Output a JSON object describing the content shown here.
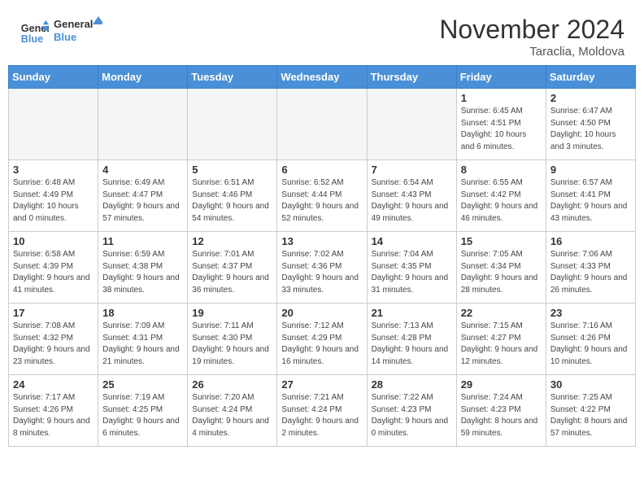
{
  "header": {
    "logo_line1": "General",
    "logo_line2": "Blue",
    "month": "November 2024",
    "location": "Taraclia, Moldova"
  },
  "days_of_week": [
    "Sunday",
    "Monday",
    "Tuesday",
    "Wednesday",
    "Thursday",
    "Friday",
    "Saturday"
  ],
  "weeks": [
    [
      {
        "day": "",
        "info": ""
      },
      {
        "day": "",
        "info": ""
      },
      {
        "day": "",
        "info": ""
      },
      {
        "day": "",
        "info": ""
      },
      {
        "day": "",
        "info": ""
      },
      {
        "day": "1",
        "info": "Sunrise: 6:45 AM\nSunset: 4:51 PM\nDaylight: 10 hours and 6 minutes."
      },
      {
        "day": "2",
        "info": "Sunrise: 6:47 AM\nSunset: 4:50 PM\nDaylight: 10 hours and 3 minutes."
      }
    ],
    [
      {
        "day": "3",
        "info": "Sunrise: 6:48 AM\nSunset: 4:49 PM\nDaylight: 10 hours and 0 minutes."
      },
      {
        "day": "4",
        "info": "Sunrise: 6:49 AM\nSunset: 4:47 PM\nDaylight: 9 hours and 57 minutes."
      },
      {
        "day": "5",
        "info": "Sunrise: 6:51 AM\nSunset: 4:46 PM\nDaylight: 9 hours and 54 minutes."
      },
      {
        "day": "6",
        "info": "Sunrise: 6:52 AM\nSunset: 4:44 PM\nDaylight: 9 hours and 52 minutes."
      },
      {
        "day": "7",
        "info": "Sunrise: 6:54 AM\nSunset: 4:43 PM\nDaylight: 9 hours and 49 minutes."
      },
      {
        "day": "8",
        "info": "Sunrise: 6:55 AM\nSunset: 4:42 PM\nDaylight: 9 hours and 46 minutes."
      },
      {
        "day": "9",
        "info": "Sunrise: 6:57 AM\nSunset: 4:41 PM\nDaylight: 9 hours and 43 minutes."
      }
    ],
    [
      {
        "day": "10",
        "info": "Sunrise: 6:58 AM\nSunset: 4:39 PM\nDaylight: 9 hours and 41 minutes."
      },
      {
        "day": "11",
        "info": "Sunrise: 6:59 AM\nSunset: 4:38 PM\nDaylight: 9 hours and 38 minutes."
      },
      {
        "day": "12",
        "info": "Sunrise: 7:01 AM\nSunset: 4:37 PM\nDaylight: 9 hours and 36 minutes."
      },
      {
        "day": "13",
        "info": "Sunrise: 7:02 AM\nSunset: 4:36 PM\nDaylight: 9 hours and 33 minutes."
      },
      {
        "day": "14",
        "info": "Sunrise: 7:04 AM\nSunset: 4:35 PM\nDaylight: 9 hours and 31 minutes."
      },
      {
        "day": "15",
        "info": "Sunrise: 7:05 AM\nSunset: 4:34 PM\nDaylight: 9 hours and 28 minutes."
      },
      {
        "day": "16",
        "info": "Sunrise: 7:06 AM\nSunset: 4:33 PM\nDaylight: 9 hours and 26 minutes."
      }
    ],
    [
      {
        "day": "17",
        "info": "Sunrise: 7:08 AM\nSunset: 4:32 PM\nDaylight: 9 hours and 23 minutes."
      },
      {
        "day": "18",
        "info": "Sunrise: 7:09 AM\nSunset: 4:31 PM\nDaylight: 9 hours and 21 minutes."
      },
      {
        "day": "19",
        "info": "Sunrise: 7:11 AM\nSunset: 4:30 PM\nDaylight: 9 hours and 19 minutes."
      },
      {
        "day": "20",
        "info": "Sunrise: 7:12 AM\nSunset: 4:29 PM\nDaylight: 9 hours and 16 minutes."
      },
      {
        "day": "21",
        "info": "Sunrise: 7:13 AM\nSunset: 4:28 PM\nDaylight: 9 hours and 14 minutes."
      },
      {
        "day": "22",
        "info": "Sunrise: 7:15 AM\nSunset: 4:27 PM\nDaylight: 9 hours and 12 minutes."
      },
      {
        "day": "23",
        "info": "Sunrise: 7:16 AM\nSunset: 4:26 PM\nDaylight: 9 hours and 10 minutes."
      }
    ],
    [
      {
        "day": "24",
        "info": "Sunrise: 7:17 AM\nSunset: 4:26 PM\nDaylight: 9 hours and 8 minutes."
      },
      {
        "day": "25",
        "info": "Sunrise: 7:19 AM\nSunset: 4:25 PM\nDaylight: 9 hours and 6 minutes."
      },
      {
        "day": "26",
        "info": "Sunrise: 7:20 AM\nSunset: 4:24 PM\nDaylight: 9 hours and 4 minutes."
      },
      {
        "day": "27",
        "info": "Sunrise: 7:21 AM\nSunset: 4:24 PM\nDaylight: 9 hours and 2 minutes."
      },
      {
        "day": "28",
        "info": "Sunrise: 7:22 AM\nSunset: 4:23 PM\nDaylight: 9 hours and 0 minutes."
      },
      {
        "day": "29",
        "info": "Sunrise: 7:24 AM\nSunset: 4:23 PM\nDaylight: 8 hours and 59 minutes."
      },
      {
        "day": "30",
        "info": "Sunrise: 7:25 AM\nSunset: 4:22 PM\nDaylight: 8 hours and 57 minutes."
      }
    ]
  ]
}
